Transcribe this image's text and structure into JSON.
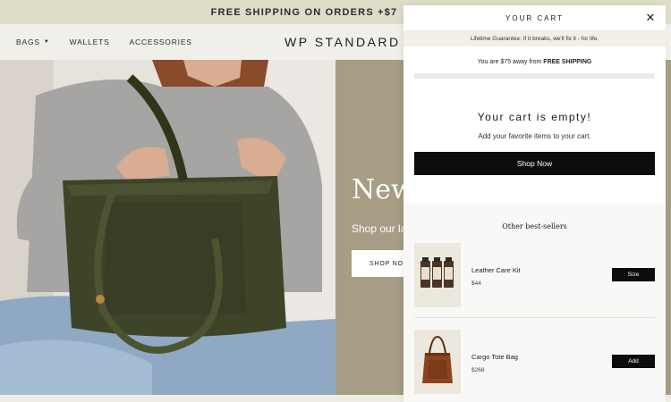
{
  "announcement": "FREE SHIPPING ON ORDERS +$7",
  "nav": {
    "links": [
      {
        "label": "BAGS"
      },
      {
        "label": "WALLETS"
      },
      {
        "label": "ACCESSORIES"
      }
    ],
    "brand": "WP STANDARD"
  },
  "hero": {
    "title": "New",
    "subtitle": "Shop our la",
    "button": "SHOP NOW"
  },
  "cart": {
    "title": "YOUR CART",
    "guarantee": "Lifetime Guarantee: If it breaks, we'll fix it - for life.",
    "shipping_prefix": "You are $75 away from ",
    "shipping_strong": "FREE SHIPPING",
    "shipping_progress": 0,
    "empty_title": "Your cart is empty!",
    "empty_sub": "Add your favorite items to your cart.",
    "shop_button": "Shop Now",
    "bestsellers_title": "Other best-sellers",
    "products": [
      {
        "name": "Leather Care Kit",
        "price": "$44",
        "button": "Size",
        "icon": "leather-care-kit-image"
      },
      {
        "name": "Cargo Tote Bag",
        "price": "$268",
        "button": "Add",
        "icon": "cargo-tote-bag-image"
      }
    ]
  },
  "colors": {
    "announcement_bg": "#dfddc8",
    "hero_panel": "#a69d84",
    "button_black": "#0d0d0d"
  }
}
